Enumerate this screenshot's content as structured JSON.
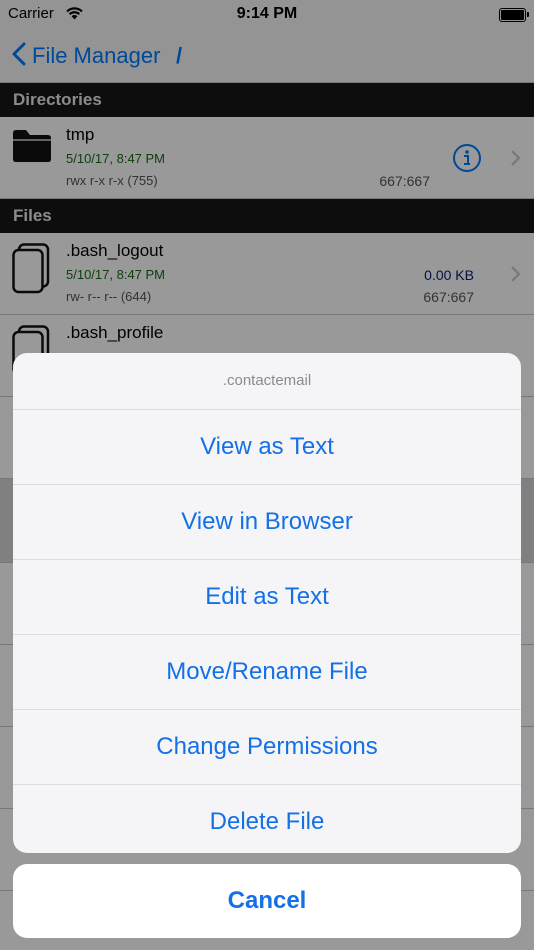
{
  "status_bar": {
    "carrier": "Carrier",
    "time": "9:14 PM"
  },
  "nav": {
    "back_label": "File Manager",
    "path_title": "/"
  },
  "directories": {
    "header": "Directories",
    "items": [
      {
        "name": "tmp",
        "date": "5/10/17, 8:47 PM",
        "permissions": "rwx r-x r-x (755)",
        "owner": "667:667"
      }
    ]
  },
  "files": {
    "header": "Files",
    "items": [
      {
        "name": ".bash_logout",
        "date": "5/10/17, 8:47 PM",
        "permissions": "rw- r-- r-- (644)",
        "size": "0.00 KB",
        "owner": "667:667"
      },
      {
        "name": ".bash_profile"
      }
    ]
  },
  "action_sheet": {
    "title": ".contactemail",
    "actions": [
      "View as Text",
      "View in Browser",
      "Edit as Text",
      "Move/Rename File",
      "Change Permissions",
      "Delete File"
    ],
    "cancel": "Cancel"
  },
  "icons": [
    "wifi-icon",
    "battery-icon",
    "back-chevron-icon",
    "folder-icon",
    "info-icon",
    "chevron-right-icon",
    "file-icon"
  ]
}
